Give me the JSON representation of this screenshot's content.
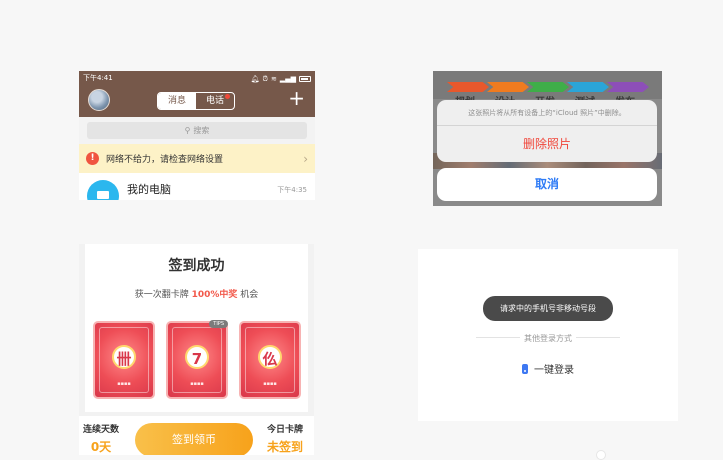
{
  "qq": {
    "status_time": "下午4:41",
    "tab_messages": "消息",
    "tab_calls": "电话",
    "plus": "+",
    "search_placeholder": "搜索",
    "alert_text": "网络不给力，请检查网络设置",
    "alert_icon": "!",
    "chat_title": "我的电脑",
    "chat_time": "下午4:35",
    "accent_color": "#76584a"
  },
  "ios_sheet": {
    "steps": [
      "规划",
      "设计",
      "开发",
      "测试",
      "发布"
    ],
    "message": "这张照片将从所有设备上的“iCloud 照片”中删除。",
    "delete_label": "删除照片",
    "cancel_label": "取消"
  },
  "checkin": {
    "title": "签到成功",
    "subtitle_prefix": "获一次翻卡牌",
    "subtitle_highlight": "100%中奖",
    "subtitle_suffix": "机会",
    "cards": [
      {
        "emblem": "卌",
        "tag": ""
      },
      {
        "emblem": "7",
        "tag": "TIPS"
      },
      {
        "emblem": "仫",
        "tag": ""
      }
    ],
    "consecutive_label": "连续天数",
    "consecutive_value": "0天",
    "button_label": "签到领币",
    "today_label": "今日卡牌",
    "today_value": "未签到"
  },
  "login": {
    "toast": "请求中的手机号非移动号段",
    "other_methods": "其他登录方式",
    "one_key": "一键登录"
  }
}
